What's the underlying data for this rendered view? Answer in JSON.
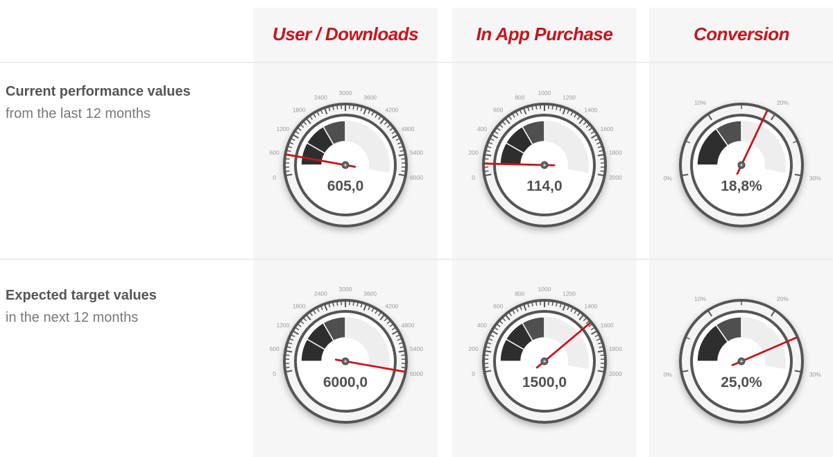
{
  "columns": [
    {
      "title": "User / Downloads"
    },
    {
      "title": "In App Purchase"
    },
    {
      "title": "Conversion"
    }
  ],
  "rows": [
    {
      "title": "Current performance values",
      "subtitle": "from the last 12 months"
    },
    {
      "title": "Expected target values",
      "subtitle": "in the next 12 months"
    }
  ],
  "gauges": [
    {
      "key": "downloads-current",
      "value": 605,
      "display": "605,0",
      "min": 0,
      "max": 6000,
      "ticks": [
        "0",
        "600",
        "1200",
        "1800",
        "2400",
        "3000",
        "3600",
        "4200",
        "4800",
        "5400",
        "6000"
      ]
    },
    {
      "key": "purchase-current",
      "value": 114,
      "display": "114,0",
      "min": 0,
      "max": 2000,
      "ticks": [
        "0",
        "200",
        "400",
        "600",
        "800",
        "1000",
        "1200",
        "1400",
        "1600",
        "1800",
        "2000"
      ]
    },
    {
      "key": "conversion-current",
      "value": 18.8,
      "display": "18,8%",
      "min": 0,
      "max": 30,
      "ticks": [
        "0%",
        "10%",
        "20%",
        "30%"
      ]
    },
    {
      "key": "downloads-target",
      "value": 6000,
      "display": "6000,0",
      "min": 0,
      "max": 6000,
      "ticks": [
        "0",
        "600",
        "1200",
        "1800",
        "2400",
        "3000",
        "3600",
        "4200",
        "4800",
        "5400",
        "6000"
      ]
    },
    {
      "key": "purchase-target",
      "value": 1500,
      "display": "1500,0",
      "min": 0,
      "max": 2000,
      "ticks": [
        "0",
        "200",
        "400",
        "600",
        "800",
        "1000",
        "1200",
        "1400",
        "1600",
        "1800",
        "2000"
      ]
    },
    {
      "key": "conversion-target",
      "value": 25,
      "display": "25,0%",
      "min": 0,
      "max": 30,
      "ticks": [
        "0%",
        "10%",
        "20%",
        "30%"
      ]
    }
  ],
  "colors": {
    "accent": "#c8141e",
    "dark": "#2e2e2e",
    "mid": "#4f4f4f",
    "track": "#efeeef",
    "ring": "#555555"
  }
}
